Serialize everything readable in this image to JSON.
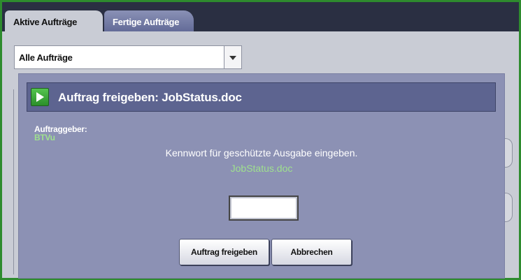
{
  "tabs": [
    {
      "label": "Aktive Aufträge",
      "active": true
    },
    {
      "label": "Fertige Aufträge",
      "active": false
    }
  ],
  "filter": {
    "selected": "Alle Aufträge"
  },
  "dialog": {
    "title": "Auftrag freigeben: JobStatus.doc",
    "owner_label": "Auftraggeber:",
    "owner_value": "BTVu",
    "prompt": "Kennwort für geschützte Ausgabe eingeben.",
    "document": "JobStatus.doc",
    "password_value": "",
    "release_button": "Auftrag freigeben",
    "cancel_button": "Abbrechen"
  },
  "colors": {
    "frame": "#2e8b2e",
    "dialog_bg": "#8c91b4",
    "titlebar_bg": "#5d6490",
    "accent_green_text": "#9fe18e"
  },
  "icons": {
    "title": "play-icon",
    "dropdown": "chevron-down-icon"
  }
}
